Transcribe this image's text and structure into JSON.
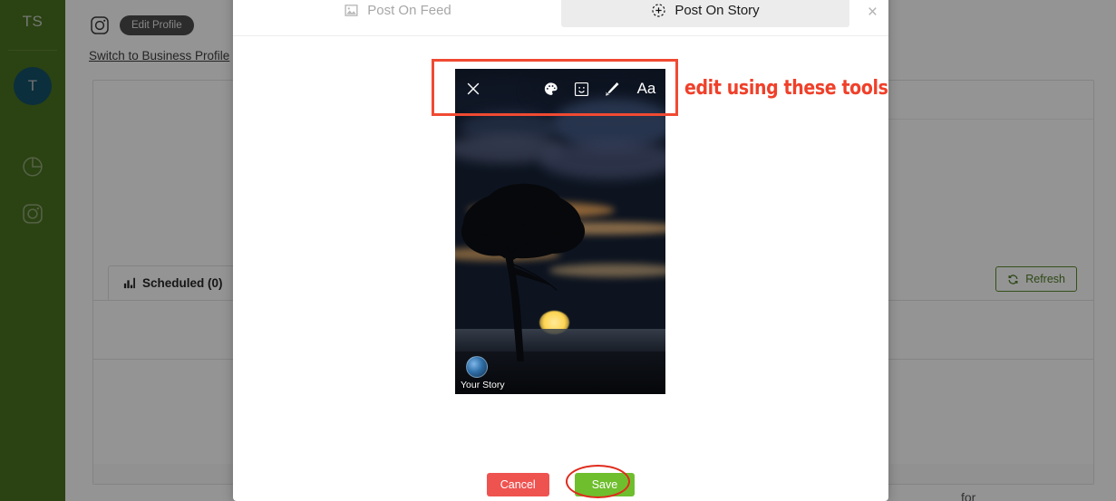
{
  "sidebar": {
    "brand": "TS",
    "avatar_initial": "T",
    "accent": "#4a7322",
    "items": [
      {
        "name": "analytics",
        "icon": "pie-chart-icon",
        "label": ""
      },
      {
        "name": "instagram",
        "icon": "instagram-icon",
        "label": ""
      }
    ]
  },
  "profile": {
    "platform_icon": "instagram-icon",
    "edit_profile_label": "Edit Profile",
    "switch_link": "Switch to Business Profile"
  },
  "panel": {
    "tabs": [
      {
        "label": "Scheduled (0)",
        "icon": "bar-chart-icon",
        "active": true
      }
    ],
    "refresh_label": "Refresh",
    "refresh_icon": "refresh-icon",
    "refresh_color": "#4f7d27",
    "text_fragment": "for"
  },
  "modal": {
    "close_label": "×",
    "tabs": [
      {
        "label": "Post On Feed",
        "icon": "image-icon",
        "active": false
      },
      {
        "label": "Post On Story",
        "icon": "plus-circle-dashed-icon",
        "active": true
      }
    ],
    "story": {
      "toolbar": [
        {
          "name": "close",
          "icon": "close-x-icon",
          "label": ""
        },
        {
          "name": "draw-color",
          "icon": "palette-icon",
          "label": ""
        },
        {
          "name": "sticker",
          "icon": "smiley-sticker-icon",
          "label": ""
        },
        {
          "name": "pen",
          "icon": "pen-icon",
          "label": ""
        },
        {
          "name": "text",
          "icon": "text-aa-icon",
          "label": "Aa"
        }
      ],
      "footer_label": "Your Story"
    },
    "buttons": {
      "cancel": "Cancel",
      "cancel_color": "#ef5350",
      "save": "Save",
      "save_color": "#6fbe2e"
    }
  },
  "annotations": {
    "callout_text": "edit using these tools",
    "callout_color": "#f0402a",
    "rect_target": "story-toolbar",
    "ellipse_target": "save-button"
  }
}
